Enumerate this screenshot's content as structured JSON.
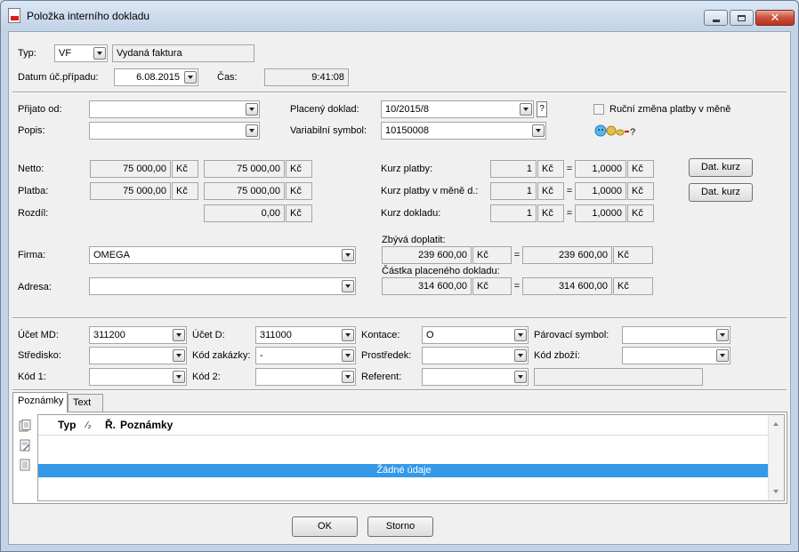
{
  "window": {
    "title": "Položka interního dokladu",
    "controls": {
      "minimize": "minimize-icon",
      "maximize": "maximize-icon",
      "close": "close-icon"
    }
  },
  "header": {
    "typ_label": "Typ:",
    "typ_value": "VF",
    "typ_desc": "Vydaná faktura",
    "datum_label": "Datum úč.případu:",
    "datum_value": "6.08.2015",
    "cas_label": "Čas:",
    "cas_value": "9:41:08"
  },
  "section1": {
    "prijato_label": "Přijato od:",
    "prijato_value": "",
    "popis_label": "Popis:",
    "popis_value": "",
    "placeny_label": "Placený doklad:",
    "placeny_value": "10/2015/8",
    "placeny_help": "?",
    "varsym_label": "Variabilní symbol:",
    "varsym_value": "10150008",
    "rucni_label": "Ruční změna platby v měně",
    "rucni_checked": false
  },
  "amounts": {
    "netto_label": "Netto:",
    "netto_val1": "75 000,00",
    "netto_val2": "75 000,00",
    "platba_label": "Platba:",
    "platba_val1": "75 000,00",
    "platba_val2": "75 000,00",
    "rozdil_label": "Rozdíl:",
    "rozdil_val": "0,00",
    "currency": "Kč"
  },
  "rates": {
    "kurz_platby_label": "Kurz platby:",
    "kurz_platby_a": "1",
    "kurz_platby_b": "1,0000",
    "kurz_mene_label": "Kurz platby v měně d.:",
    "kurz_mene_a": "1",
    "kurz_mene_b": "1,0000",
    "kurz_dokladu_label": "Kurz dokladu:",
    "kurz_dokladu_a": "1",
    "kurz_dokladu_b": "1,0000",
    "dat_kurz_btn": "Dat. kurz",
    "eq": "="
  },
  "firma": {
    "firma_label": "Firma:",
    "firma_value": "OMEGA",
    "adresa_label": "Adresa:",
    "adresa_value": "",
    "zbyva_label": "Zbývá doplatit:",
    "zbyva_val1": "239 600,00",
    "zbyva_val2": "239 600,00",
    "castka_label": "Částka placeného dokladu:",
    "castka_val1": "314 600,00",
    "castka_val2": "314 600,00"
  },
  "accounts": {
    "ucet_md_label": "Účet MD:",
    "ucet_md_value": "311200",
    "ucet_d_label": "Účet D:",
    "ucet_d_value": "311000",
    "kontace_label": "Kontace:",
    "kontace_value": "O",
    "parovaci_label": "Párovací symbol:",
    "parovaci_value": "",
    "stredisko_label": "Středisko:",
    "stredisko_value": "",
    "kod_zakazky_label": "Kód zakázky:",
    "kod_zakazky_value": "-",
    "prostredek_label": "Prostředek:",
    "prostredek_value": "",
    "kod_zbozi_label": "Kód zboží:",
    "kod_zbozi_value": "",
    "kod1_label": "Kód 1:",
    "kod1_value": "",
    "kod2_label": "Kód 2:",
    "kod2_value": "",
    "referent_label": "Referent:",
    "referent_value": "",
    "referent_desc": ""
  },
  "tabs": [
    {
      "label": "Poznámky",
      "active": true
    },
    {
      "label": "Text",
      "active": false
    }
  ],
  "notes_grid": {
    "col_typ": "Typ",
    "col_sort": "⁄₂",
    "col_r": "Ř.",
    "col_poznamky": "Poznámky",
    "empty_text": "Žádné údaje"
  },
  "footer": {
    "ok": "OK",
    "cancel": "Storno"
  }
}
